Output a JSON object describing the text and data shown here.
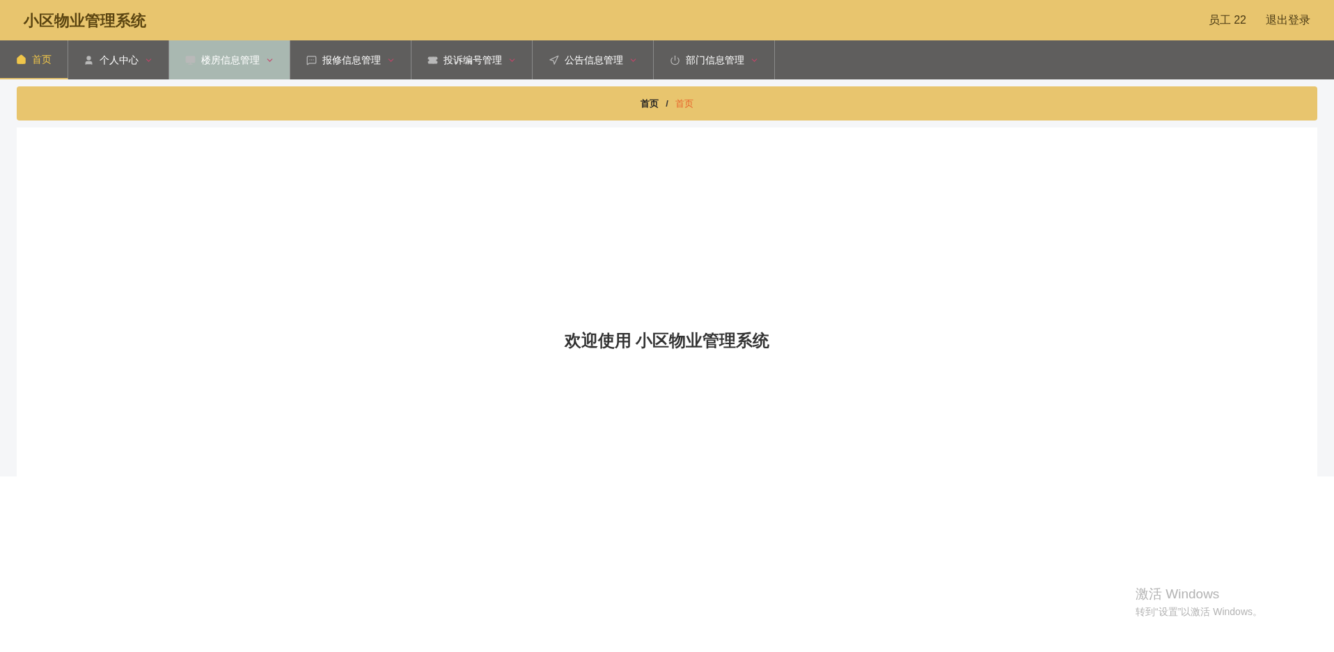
{
  "header": {
    "title": "小区物业管理系统",
    "user": "员工 22",
    "logout": "退出登录"
  },
  "nav": [
    {
      "label": "首页",
      "selected": true,
      "hovered": false
    },
    {
      "label": "个人中心",
      "selected": false,
      "hovered": false
    },
    {
      "label": "楼房信息管理",
      "selected": false,
      "hovered": true
    },
    {
      "label": "报修信息管理",
      "selected": false,
      "hovered": false
    },
    {
      "label": "投诉编号管理",
      "selected": false,
      "hovered": false
    },
    {
      "label": "公告信息管理",
      "selected": false,
      "hovered": false
    },
    {
      "label": "部门信息管理",
      "selected": false,
      "hovered": false
    }
  ],
  "breadcrumb": {
    "items": [
      "首页",
      "首页"
    ],
    "separator": "/"
  },
  "welcome": "欢迎使用 小区物业管理系统",
  "os_notice": {
    "title": "激活 Windows",
    "text": "转到“设置”以激活 Windows。"
  }
}
